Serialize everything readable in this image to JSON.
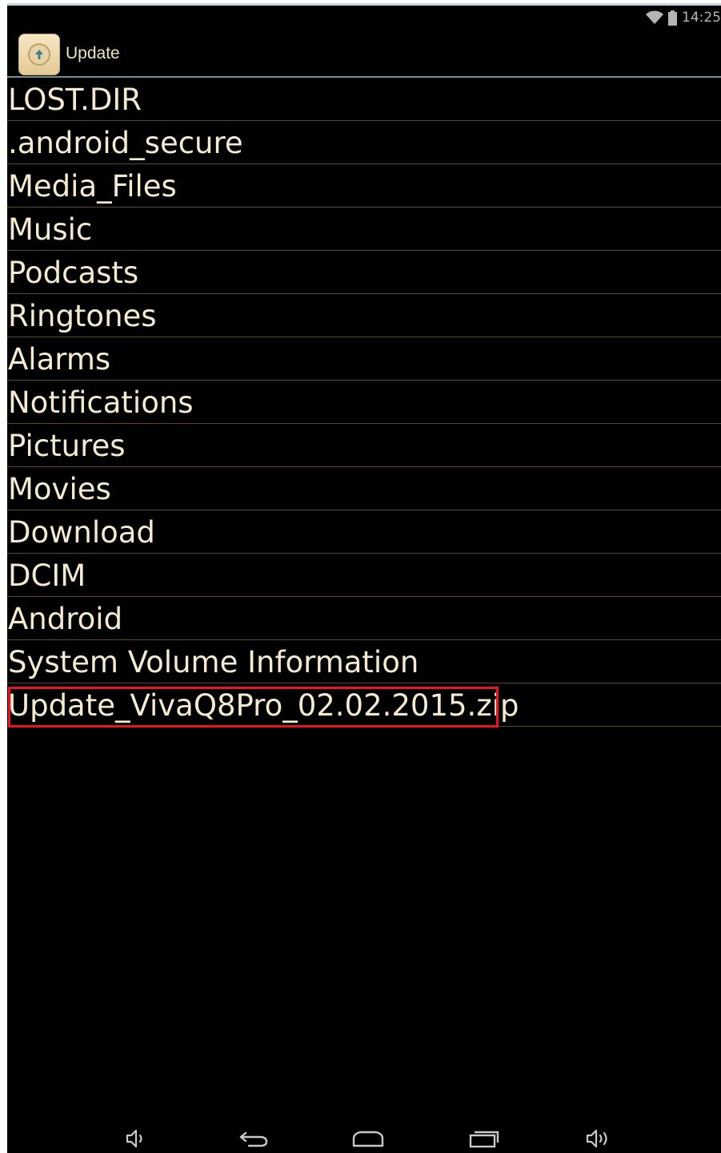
{
  "status_bar": {
    "time": "14:25",
    "wifi_icon": "wifi-icon",
    "battery_icon": "battery-icon"
  },
  "action_bar": {
    "title": "Update",
    "up_icon": "arrow-up-icon"
  },
  "file_list": {
    "items": [
      "LOST.DIR",
      ".android_secure",
      "Media_Files",
      "Music",
      "Podcasts",
      "Ringtones",
      "Alarms",
      "Notifications",
      "Pictures",
      "Movies",
      "Download",
      "DCIM",
      "Android",
      "System Volume Information",
      "Update_VivaQ8Pro_02.02.2015.zip"
    ],
    "highlighted_item": "Update_VivaQ8Pro_02.02.2015.zip"
  },
  "nav_bar": {
    "buttons": [
      "volume-down-icon",
      "back-icon",
      "home-icon",
      "recent-apps-icon",
      "volume-up-icon"
    ]
  },
  "colors": {
    "background": "#000000",
    "list_text": "#f4ead2",
    "divider": "#5a4a2a",
    "highlight_border": "#e8141e",
    "action_bar_divider": "#6f8f99"
  }
}
